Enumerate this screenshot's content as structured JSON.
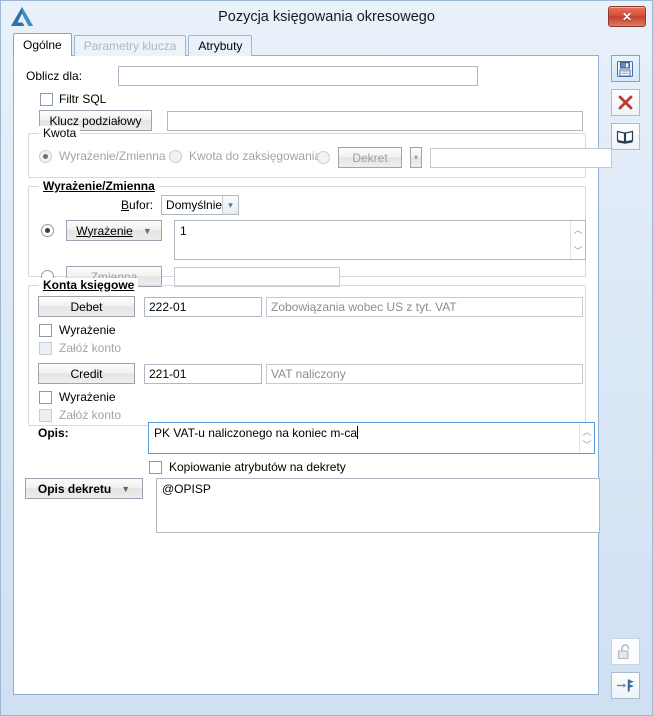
{
  "window": {
    "title": "Pozycja księgowania okresowego",
    "logo_icon": "comarch-triangle-logo",
    "close_label": "✕"
  },
  "tabs": [
    {
      "label": "Ogólne",
      "state": "active",
      "name": "tab-ogolne"
    },
    {
      "label": "Parametry klucza",
      "state": "disabled",
      "name": "tab-parametry-klucza"
    },
    {
      "label": "Atrybuty",
      "state": "enabled",
      "name": "tab-atrybuty"
    }
  ],
  "form": {
    "oblicz_dla_label": "Oblicz dla:",
    "oblicz_dla_value": "",
    "filtr_sql_label": "Filtr SQL",
    "filtr_sql_checked": false,
    "klucz_podzialowy_button": "Klucz podziałowy",
    "klucz_podzialowy_value": ""
  },
  "kwota": {
    "title": "Kwota",
    "option_wyrazenie_zmienna": "Wyrażenie/Zmienna",
    "option_kwota_do_zaksiegowania": "Kwota do zaksięgowania",
    "selected": "Wyrażenie/Zmienna",
    "dekret_button": "Dekret",
    "dekret_value": ""
  },
  "wyrazenie_zmienna": {
    "title": "Wyrażenie/Zmienna",
    "bufor_label": "Bufor:",
    "bufor_label_accel": "B",
    "bufor_label_rest": "ufor:",
    "bufor_value": "Domyślnie",
    "wyrazenie_button": "Wyrażenie",
    "wyrazenie_value": "1",
    "zmienna_button": "Zmienna",
    "zmienna_value": "",
    "selected": "Wyrażenie"
  },
  "konta_ksiegowe": {
    "title": "Konta księgowe",
    "rows": [
      {
        "button": "Debet",
        "account": "222-01",
        "description": "Zobowiązania wobec US z tyt. VAT",
        "wyrazenie_label": "Wyrażenie",
        "wyrazenie_checked": false,
        "zaloz_konto_label": "Załóż konto",
        "zaloz_konto_checked": false,
        "zaloz_konto_disabled": true
      },
      {
        "button": "Credit",
        "account": "221-01",
        "description": "VAT naliczony",
        "wyrazenie_label": "Wyrażenie",
        "wyrazenie_checked": false,
        "zaloz_konto_label": "Załóż konto",
        "zaloz_konto_checked": false,
        "zaloz_konto_disabled": true
      }
    ]
  },
  "opis": {
    "label": "Opis:",
    "value": "PK VAT-u naliczonego na koniec m-ca",
    "focused": true,
    "kopiowanie_label": "Kopiowanie atrybutów na dekrety",
    "kopiowanie_checked": false,
    "opis_dekretu_button": "Opis dekretu",
    "opis_dekretu_value": "@OPISP"
  },
  "toolbar": {
    "top": [
      {
        "name": "save-button",
        "icon": "floppy-disk-icon",
        "state": "selected"
      },
      {
        "name": "cancel-button",
        "icon": "red-x-icon",
        "state": "framed"
      },
      {
        "name": "help-button",
        "icon": "open-book-icon",
        "state": "framed"
      }
    ],
    "bottom": [
      {
        "name": "unlock-button",
        "icon": "open-padlock-icon",
        "state": "disabled"
      },
      {
        "name": "bookmark-button",
        "icon": "blue-flag-icon",
        "state": "framed"
      }
    ]
  },
  "colors": {
    "window_frame": "#cfe0f2",
    "accent_blue": "#2b6ca3",
    "close_red": "#d9503c",
    "disabled_text": "#a4a4a4",
    "field_border": "#aeb9c4",
    "focus_border": "#5a9bd5"
  }
}
